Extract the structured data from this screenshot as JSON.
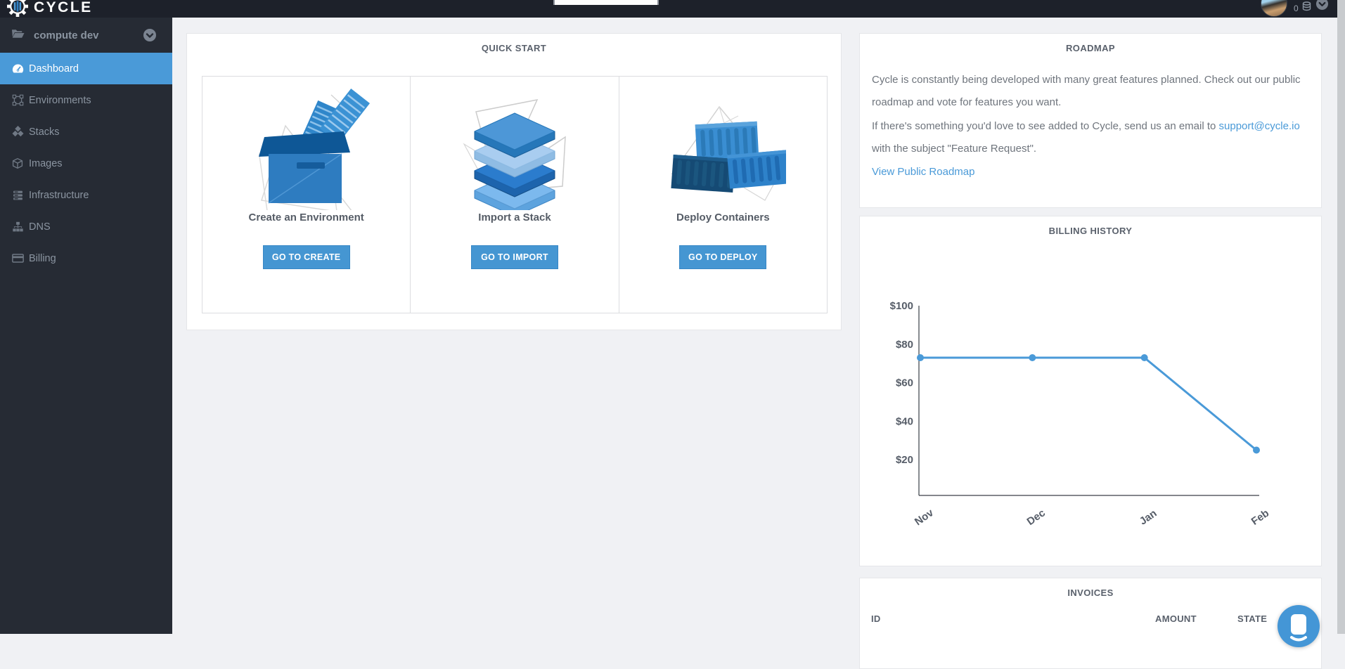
{
  "navbar": {
    "logo_text": "CYCLE",
    "credits_count": "0"
  },
  "sidebar": {
    "hub_label": "compute dev",
    "items": [
      {
        "label": "Dashboard",
        "icon": "gauge-icon",
        "active": true
      },
      {
        "label": "Environments",
        "icon": "frame-icon",
        "active": false
      },
      {
        "label": "Stacks",
        "icon": "cubes-icon",
        "active": false
      },
      {
        "label": "Images",
        "icon": "cube-icon",
        "active": false
      },
      {
        "label": "Infrastructure",
        "icon": "server-icon",
        "active": false
      },
      {
        "label": "DNS",
        "icon": "sitemap-icon",
        "active": false
      },
      {
        "label": "Billing",
        "icon": "credit-card-icon",
        "active": false
      }
    ]
  },
  "quick_start": {
    "title": "QUICK START",
    "cards": [
      {
        "title": "Create an Environment",
        "button_label": "GO TO CREATE",
        "illustration": "environment-box-illustration"
      },
      {
        "title": "Import a Stack",
        "button_label": "GO TO IMPORT",
        "illustration": "stack-layers-illustration"
      },
      {
        "title": "Deploy Containers",
        "button_label": "GO TO DEPLOY",
        "illustration": "shipping-containers-illustration"
      }
    ]
  },
  "roadmap": {
    "title": "ROADMAP",
    "paragraph_1": "Cycle is constantly being developed with many great features planned. Check out our public roadmap and vote for features you want.",
    "paragraph_2_before_link": "If there's something you'd love to see added to Cycle, send us an email to ",
    "email_link": "support@cycle.io",
    "paragraph_2_after_link": " with the subject \"Feature Request\".",
    "view_link": "View Public Roadmap"
  },
  "billing_history": {
    "title": "BILLING HISTORY",
    "chart_data": {
      "type": "line",
      "x": [
        "Nov",
        "Dec",
        "Jan",
        "Feb"
      ],
      "values": [
        73,
        73,
        73,
        25
      ],
      "y_tick_labels": [
        "$100",
        "$80",
        "$60",
        "$40",
        "$20"
      ],
      "y_tick_values": [
        100,
        80,
        60,
        40,
        20
      ],
      "ylim": [
        0,
        100
      ],
      "grid": false,
      "legend": "none",
      "line_color": "#4a9ad8"
    }
  },
  "invoices": {
    "title": "INVOICES",
    "columns": [
      "ID",
      "AMOUNT",
      "STATE"
    ]
  },
  "colors": {
    "accent_blue": "#4a9ad8",
    "button_blue": "#4596d2",
    "navbar_bg": "#1d212a",
    "sidebar_bg": "#262b34",
    "page_bg": "#f0f1f4",
    "panel_title_gray": "#5a616c"
  }
}
